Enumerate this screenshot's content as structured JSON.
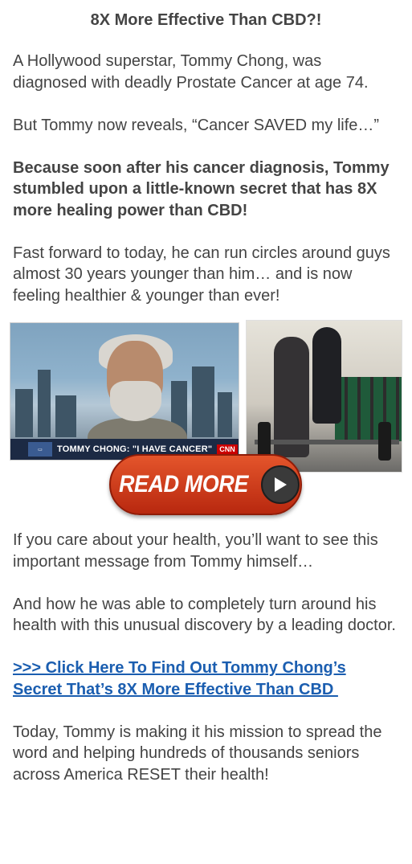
{
  "headline": "8X More Effective Than CBD?!",
  "paragraphs": {
    "intro": "A Hollywood superstar, Tommy Chong, was diagnosed with deadly Prostate Cancer at age 74.",
    "reveal": "But Tommy now reveals, “Cancer SAVED my life…”",
    "bold_secret": "Because soon after his cancer diagnosis, Tommy stumbled upon a little-known secret that has 8X more healing power than CBD!",
    "fast_forward": "Fast forward to today, he can run circles around guys almost 30 years younger than him… and is now feeling healthier & younger than ever!",
    "care": "If you care about your health, you’ll want to see this important message from Tommy himself…",
    "turnaround": "And how he was able to completely turn around his health with this unusual discovery by a leading doctor.",
    "mission": "Today, Tommy is making it his mission to spread the word and helping hundreds of thousands seniors across America RESET their health!"
  },
  "media": {
    "news_ticker": "TOMMY CHONG: \"I HAVE CANCER\"",
    "news_network": "CNN",
    "read_more_label": "READ MORE"
  },
  "cta_link": "&gt;&gt;&gt; Click Here To Find Out Tommy Chong’s Secret That’s 8X More Effective Than CBD",
  "colors": {
    "text": "#444444",
    "link": "#1b5eb0",
    "button": "#c93a1a"
  }
}
